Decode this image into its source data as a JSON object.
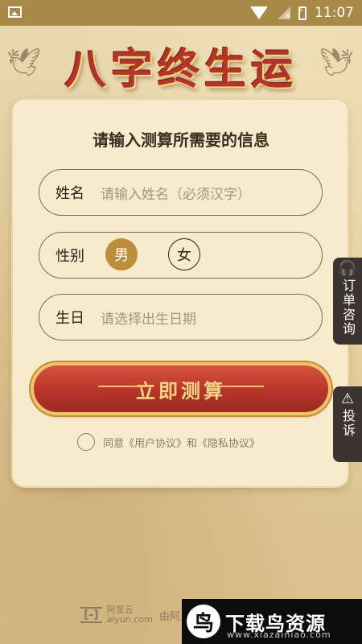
{
  "status_bar": {
    "time": "11:07",
    "icons": [
      "image-icon",
      "wifi-icon",
      "no-signal-icon",
      "battery-charging-icon"
    ]
  },
  "header": {
    "title": "八字终生运",
    "decor_icons": [
      "crane-icon",
      "crane-icon"
    ]
  },
  "form": {
    "heading": "请输入测算所需要的信息",
    "name": {
      "label": "姓名",
      "placeholder": "请输入姓名（必须汉字）"
    },
    "gender": {
      "label": "性别",
      "options": [
        "男",
        "女"
      ],
      "selected": "男"
    },
    "birthday": {
      "label": "生日",
      "placeholder": "请选择出生日期"
    },
    "submit_label": "立即测算",
    "agreement": {
      "text": "同意《用户协议》和《隐私协议》",
      "checked": false
    }
  },
  "side_tabs": {
    "consult": {
      "label": "订单咨询",
      "icon": "headset-icon"
    },
    "complain": {
      "label": "投诉",
      "icon": "warning-icon"
    }
  },
  "footer": {
    "brand": "阿里云",
    "brand_url": "aiyun.com",
    "by_text": "由阿里"
  },
  "watermark": {
    "title": "下载鸟资源",
    "url": "www.xiazainiao.com"
  },
  "colors": {
    "status_bar": "#a88948",
    "title_red": "#b3342a",
    "button_red": "#b8352a",
    "gender_selected": "#bc8d3b",
    "side_tab": "#3b3430"
  }
}
